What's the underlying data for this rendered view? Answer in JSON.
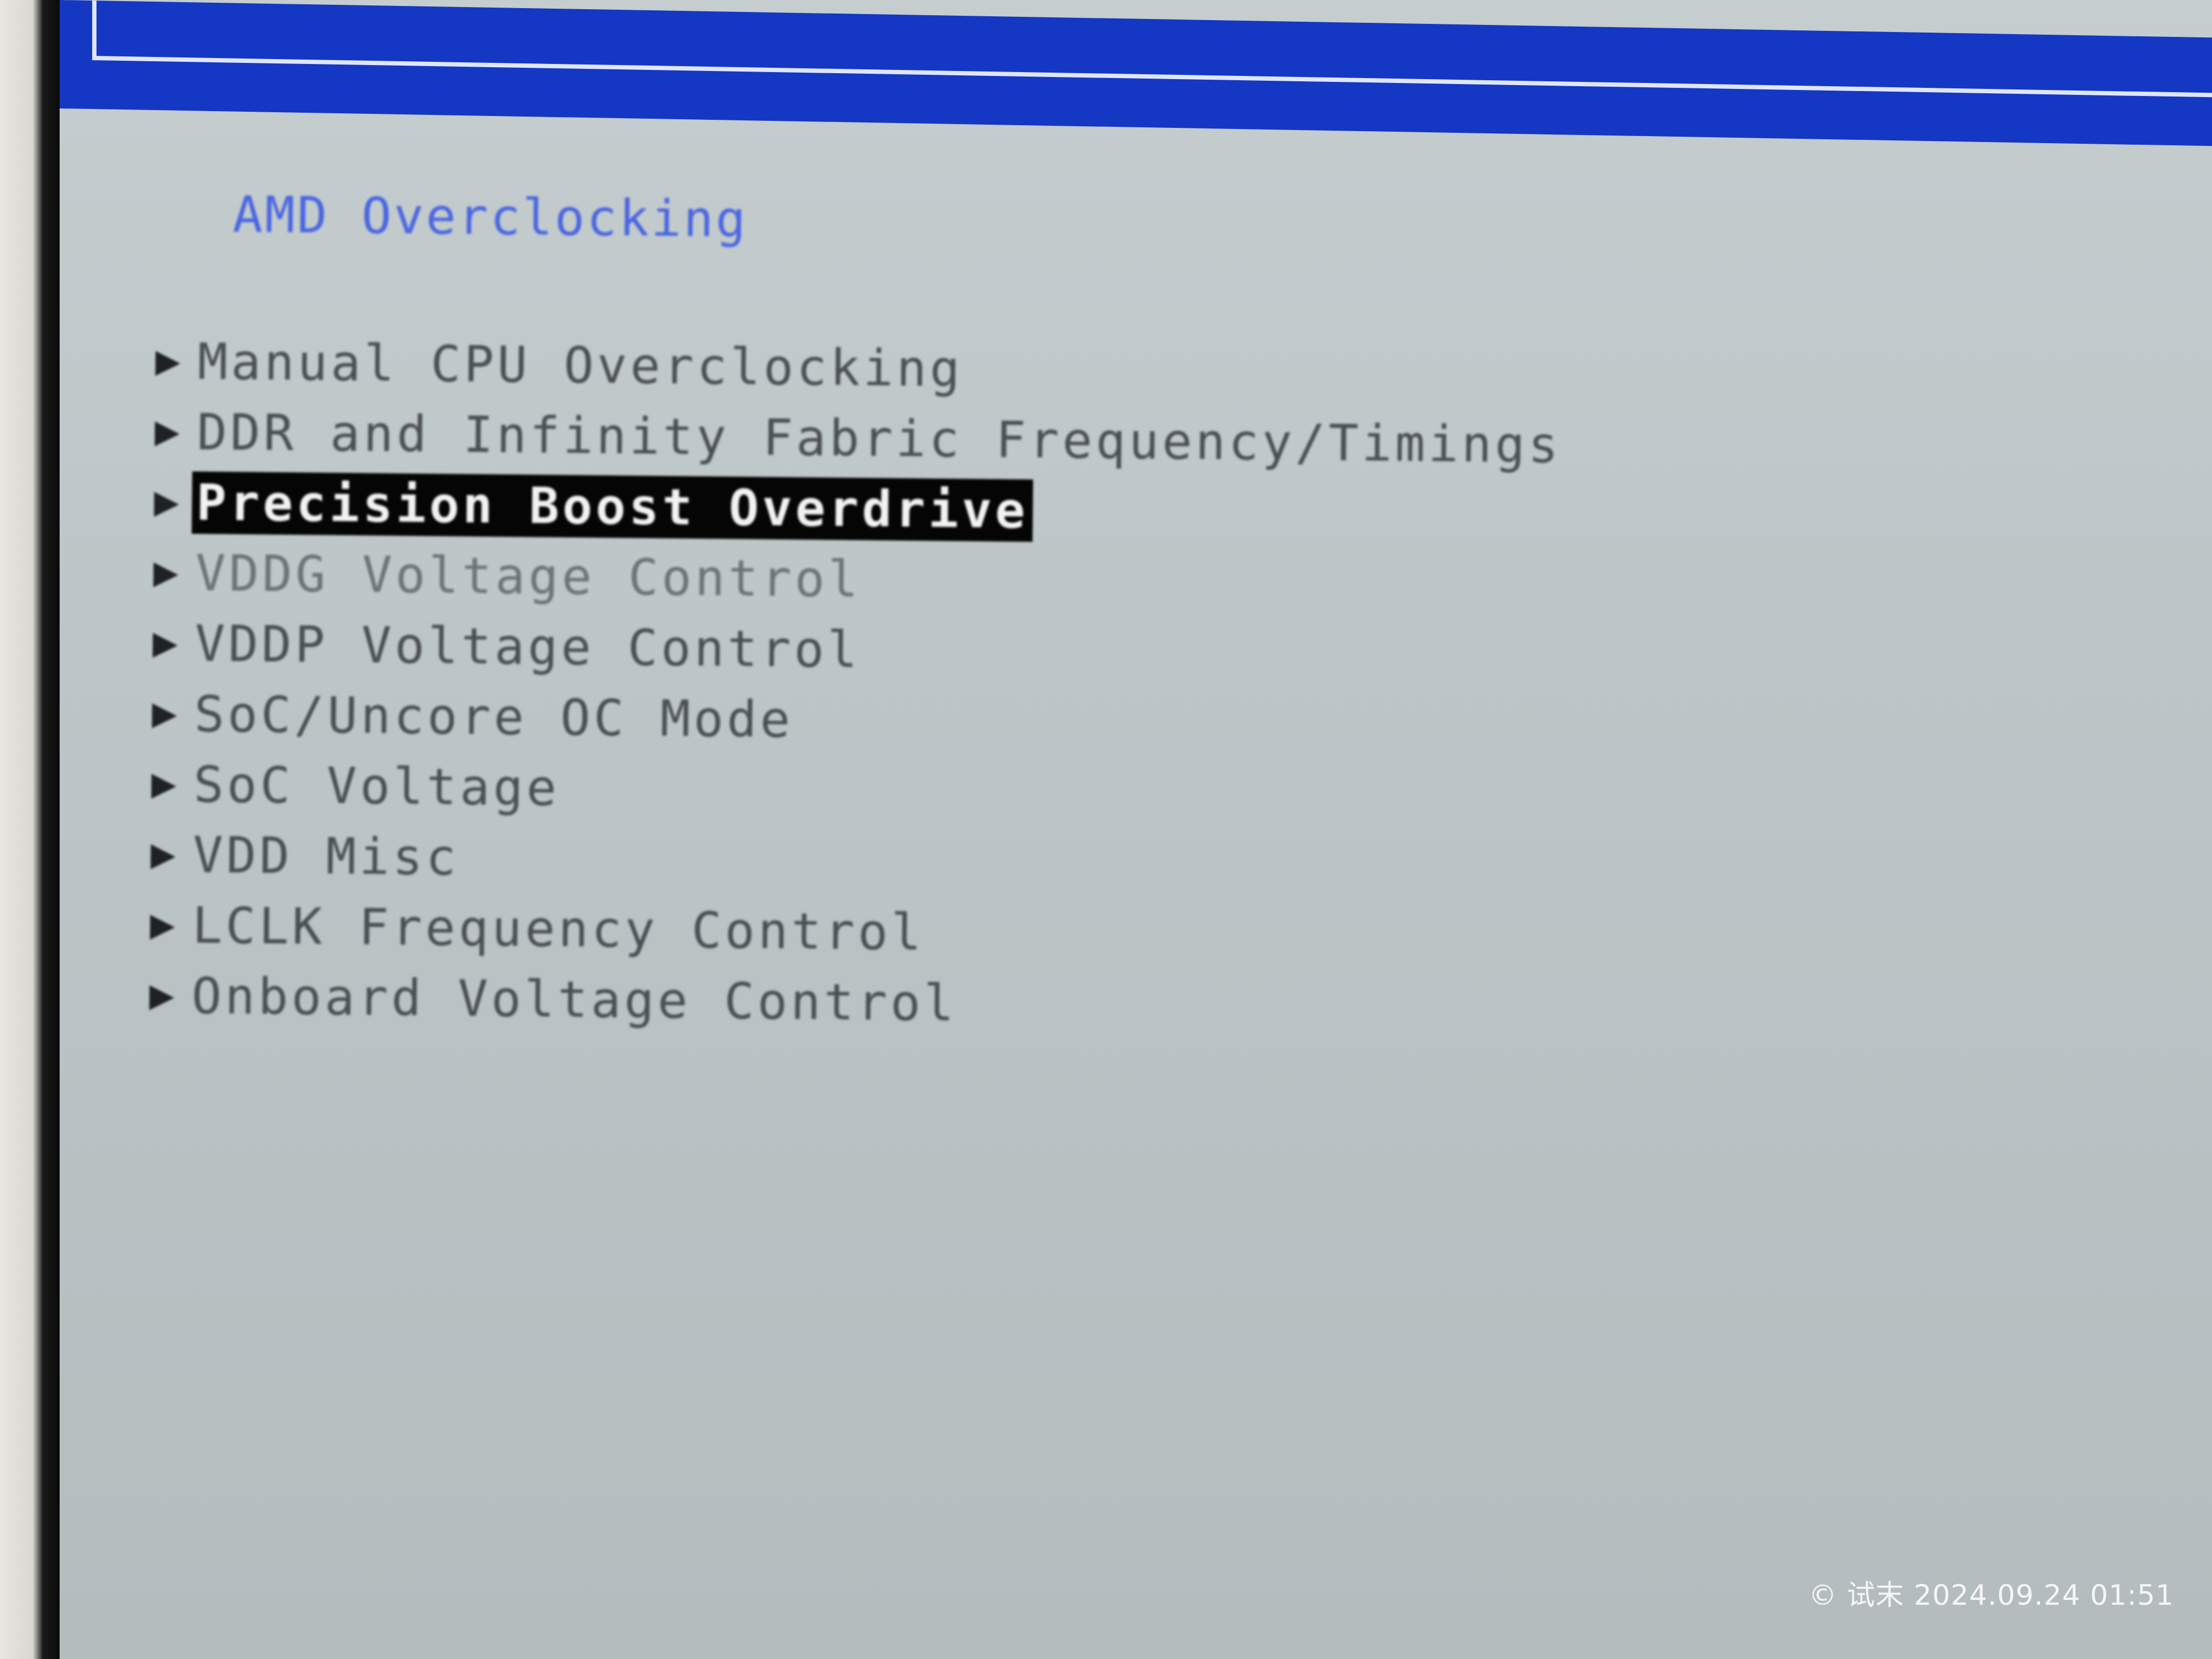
{
  "bios": {
    "section_title": "AMD Overclocking",
    "menu": [
      {
        "label": "Manual CPU Overclocking",
        "selected": false,
        "faint": false
      },
      {
        "label": "DDR and Infinity Fabric Frequency/Timings",
        "selected": false,
        "faint": false
      },
      {
        "label": "Precision Boost Overdrive",
        "selected": true,
        "faint": false
      },
      {
        "label": "VDDG Voltage Control",
        "selected": false,
        "faint": true
      },
      {
        "label": "VDDP Voltage Control",
        "selected": false,
        "faint": false
      },
      {
        "label": "SoC/Uncore OC Mode",
        "selected": false,
        "faint": false
      },
      {
        "label": "SoC Voltage",
        "selected": false,
        "faint": false
      },
      {
        "label": "VDD Misc",
        "selected": false,
        "faint": false
      },
      {
        "label": "LCLK Frequency Control",
        "selected": false,
        "faint": false
      },
      {
        "label": "Onboard Voltage Control",
        "selected": false,
        "faint": false
      }
    ],
    "submenu_arrow_icon": "triangle-right-icon"
  },
  "photo_watermark": {
    "text": "© 试末 2024.09.24 01:51"
  },
  "colors": {
    "header_bar": "#1437c4",
    "screen_background": "#bcc5c7",
    "title_text": "#4a66e0",
    "selection_background": "#050505",
    "selection_text": "#f2f2f2"
  }
}
